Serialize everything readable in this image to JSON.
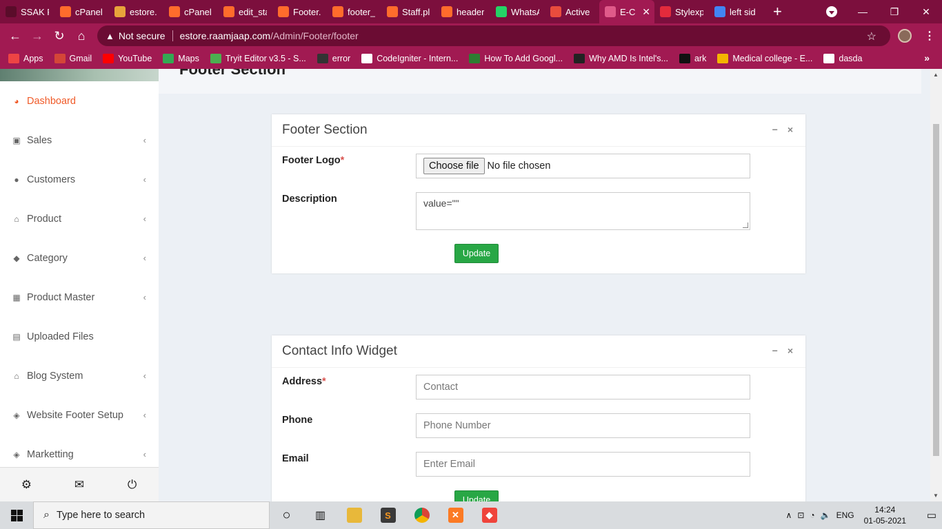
{
  "browser": {
    "tabs": [
      {
        "title": "SSAK P",
        "icon": "ssak-icon",
        "color": "#5a0c2a"
      },
      {
        "title": "cPanel",
        "icon": "cpanel-icon",
        "color": "#ff6c2c"
      },
      {
        "title": "estore.",
        "icon": "estore-icon",
        "color": "#e8a33b"
      },
      {
        "title": "cPanel",
        "icon": "cpanel-icon",
        "color": "#ff6c2c"
      },
      {
        "title": "edit_sta",
        "icon": "cpanel-icon",
        "color": "#ff6c2c"
      },
      {
        "title": "Footer.",
        "icon": "cpanel-icon",
        "color": "#ff6c2c"
      },
      {
        "title": "footer_",
        "icon": "cpanel-icon",
        "color": "#ff6c2c"
      },
      {
        "title": "Staff.pl",
        "icon": "cpanel-icon",
        "color": "#ff6c2c"
      },
      {
        "title": "header",
        "icon": "cpanel-icon",
        "color": "#ff6c2c"
      },
      {
        "title": "WhatsA",
        "icon": "whatsapp-icon",
        "color": "#25d366"
      },
      {
        "title": "Active",
        "icon": "shop-icon",
        "color": "#e94c3d"
      },
      {
        "title": "E-C",
        "icon": "ecommerce-icon",
        "color": "#e05a8a",
        "active": true
      },
      {
        "title": "Stylexp",
        "icon": "stylexp-icon",
        "color": "#e32b3c"
      },
      {
        "title": "left sid",
        "icon": "google-icon",
        "color": "#4285f4"
      }
    ],
    "address": {
      "security": "Not secure",
      "domain": "estore.raamjaap.com",
      "path": "/Admin/Footer/footer"
    },
    "bookmarks": [
      {
        "label": "Apps",
        "color": "#e44"
      },
      {
        "label": "Gmail",
        "color": "#d44638"
      },
      {
        "label": "YouTube",
        "color": "#ff0000"
      },
      {
        "label": "Maps",
        "color": "#34a853"
      },
      {
        "label": "Tryit Editor v3.5 - S...",
        "color": "#4caf50"
      },
      {
        "label": "error",
        "color": "#333"
      },
      {
        "label": "CodeIgniter - Intern...",
        "color": "#fff"
      },
      {
        "label": "How To Add Googl...",
        "color": "#2e7d32"
      },
      {
        "label": "Why AMD Is Intel's...",
        "color": "#222"
      },
      {
        "label": "ark",
        "color": "#111"
      },
      {
        "label": "Medical college - E...",
        "color": "#f4b400"
      },
      {
        "label": "dasda",
        "color": "#fff"
      }
    ]
  },
  "sidebar": {
    "items": [
      {
        "label": "Dashboard",
        "icon": "dashboard-icon",
        "glyph": "◕",
        "active": true,
        "has_sub": false
      },
      {
        "label": "Sales",
        "icon": "money-icon",
        "glyph": "▣",
        "has_sub": true
      },
      {
        "label": "Customers",
        "icon": "users-icon",
        "glyph": "●",
        "has_sub": true
      },
      {
        "label": "Product",
        "icon": "basket-icon",
        "glyph": "⌂",
        "has_sub": true
      },
      {
        "label": "Category",
        "icon": "tags-icon",
        "glyph": "◆",
        "has_sub": true
      },
      {
        "label": "Product Master",
        "icon": "grid-icon",
        "glyph": "▦",
        "has_sub": true
      },
      {
        "label": "Uploaded Files",
        "icon": "image-file-icon",
        "glyph": "▤",
        "has_sub": false
      },
      {
        "label": "Blog System",
        "icon": "basket-icon",
        "glyph": "⌂",
        "has_sub": true
      },
      {
        "label": "Website Footer Setup",
        "icon": "tag-icon",
        "glyph": "◈",
        "has_sub": true
      },
      {
        "label": "Marketting",
        "icon": "tag-icon",
        "glyph": "◈",
        "has_sub": true
      }
    ],
    "footer": [
      "gear-icon",
      "envelope-icon",
      "power-icon"
    ]
  },
  "page": {
    "title": "Footer Section"
  },
  "footer_section": {
    "title": "Footer Section",
    "logo_label": "Footer Logo",
    "required_mark": "*",
    "file_button": "Choose file",
    "file_status": "No file chosen",
    "description_label": "Description",
    "description_value": "value=\"\"",
    "update_label": "Update"
  },
  "contact_widget": {
    "title": "Contact Info Widget",
    "address_label": "Address",
    "required_mark": "*",
    "address_placeholder": "Contact",
    "phone_label": "Phone",
    "phone_placeholder": "Phone Number",
    "email_label": "Email",
    "email_placeholder": "Enter Email",
    "update_label": "Update"
  },
  "taskbar": {
    "search_placeholder": "Type here to search",
    "language": "ENG",
    "time": "14:24",
    "date": "01-05-2021"
  }
}
